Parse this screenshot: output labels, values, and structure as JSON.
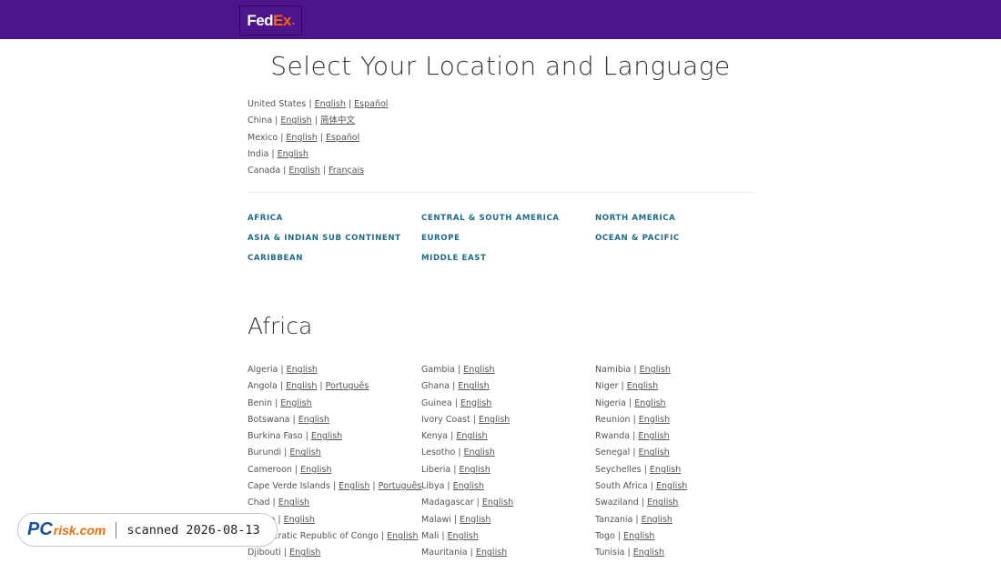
{
  "header": {
    "logo_fed": "Fed",
    "logo_ex": "Ex",
    "logo_dot": "."
  },
  "page_title": "Select Your Location and Language",
  "featured": [
    {
      "country": "United States",
      "langs": [
        "English",
        "Español"
      ]
    },
    {
      "country": "China",
      "langs": [
        "English",
        "简体中文"
      ]
    },
    {
      "country": "Mexico",
      "langs": [
        "English",
        "Español"
      ]
    },
    {
      "country": "India",
      "langs": [
        "English"
      ]
    },
    {
      "country": "Canada",
      "langs": [
        "English",
        "Français"
      ]
    }
  ],
  "regions": {
    "africa": "AFRICA",
    "asia": "ASIA & INDIAN SUB CONTINENT",
    "caribbean": "CARIBBEAN",
    "central_south_america": "CENTRAL & SOUTH AMERICA",
    "europe": "EUROPE",
    "middle_east": "MIDDLE EAST",
    "north_america": "NORTH AMERICA",
    "ocean_pacific": "OCEAN & PACIFIC"
  },
  "section_title": "Africa",
  "africa_columns": [
    [
      {
        "country": "Algeria",
        "langs": [
          "English"
        ]
      },
      {
        "country": "Angola",
        "langs": [
          "English",
          "Português"
        ]
      },
      {
        "country": "Benin",
        "langs": [
          "English"
        ]
      },
      {
        "country": "Botswana",
        "langs": [
          "English"
        ]
      },
      {
        "country": "Burkina Faso",
        "langs": [
          "English"
        ]
      },
      {
        "country": "Burundi",
        "langs": [
          "English"
        ]
      },
      {
        "country": "Cameroon",
        "langs": [
          "English"
        ]
      },
      {
        "country": "Cape Verde Islands",
        "langs": [
          "English",
          "Português"
        ]
      },
      {
        "country": "Chad",
        "langs": [
          "English"
        ]
      },
      {
        "country": "Congo",
        "langs": [
          "English"
        ]
      },
      {
        "country": "Democratic Republic of Congo",
        "langs": [
          "English"
        ]
      },
      {
        "country": "Djibouti",
        "langs": [
          "English"
        ]
      }
    ],
    [
      {
        "country": "Gambia",
        "langs": [
          "English"
        ]
      },
      {
        "country": "Ghana",
        "langs": [
          "English"
        ]
      },
      {
        "country": "Guinea",
        "langs": [
          "English"
        ]
      },
      {
        "country": "Ivory Coast",
        "langs": [
          "English"
        ]
      },
      {
        "country": "Kenya",
        "langs": [
          "English"
        ]
      },
      {
        "country": "Lesotho",
        "langs": [
          "English"
        ]
      },
      {
        "country": "Liberia",
        "langs": [
          "English"
        ]
      },
      {
        "country": "Libya",
        "langs": [
          "English"
        ]
      },
      {
        "country": "Madagascar",
        "langs": [
          "English"
        ]
      },
      {
        "country": "Malawi",
        "langs": [
          "English"
        ]
      },
      {
        "country": "Mali",
        "langs": [
          "English"
        ]
      },
      {
        "country": "Mauritania",
        "langs": [
          "English"
        ]
      }
    ],
    [
      {
        "country": "Namibia",
        "langs": [
          "English"
        ]
      },
      {
        "country": "Niger",
        "langs": [
          "English"
        ]
      },
      {
        "country": "Nigeria",
        "langs": [
          "English"
        ]
      },
      {
        "country": "Reunion",
        "langs": [
          "English"
        ]
      },
      {
        "country": "Rwanda",
        "langs": [
          "English"
        ]
      },
      {
        "country": "Senegal",
        "langs": [
          "English"
        ]
      },
      {
        "country": "Seychelles",
        "langs": [
          "English"
        ]
      },
      {
        "country": "South Africa",
        "langs": [
          "English"
        ]
      },
      {
        "country": "Swaziland",
        "langs": [
          "English"
        ]
      },
      {
        "country": "Tanzania",
        "langs": [
          "English"
        ]
      },
      {
        "country": "Togo",
        "langs": [
          "English"
        ]
      },
      {
        "country": "Tunisia",
        "langs": [
          "English"
        ]
      }
    ]
  ],
  "watermark": {
    "brand_pc": "PC",
    "brand_risk": "risk.com",
    "text": "scanned 2026-08-13"
  },
  "colors": {
    "header_bg": "#4d148c",
    "region_link": "#1c6b8a",
    "logo_orange": "#ff6200"
  }
}
